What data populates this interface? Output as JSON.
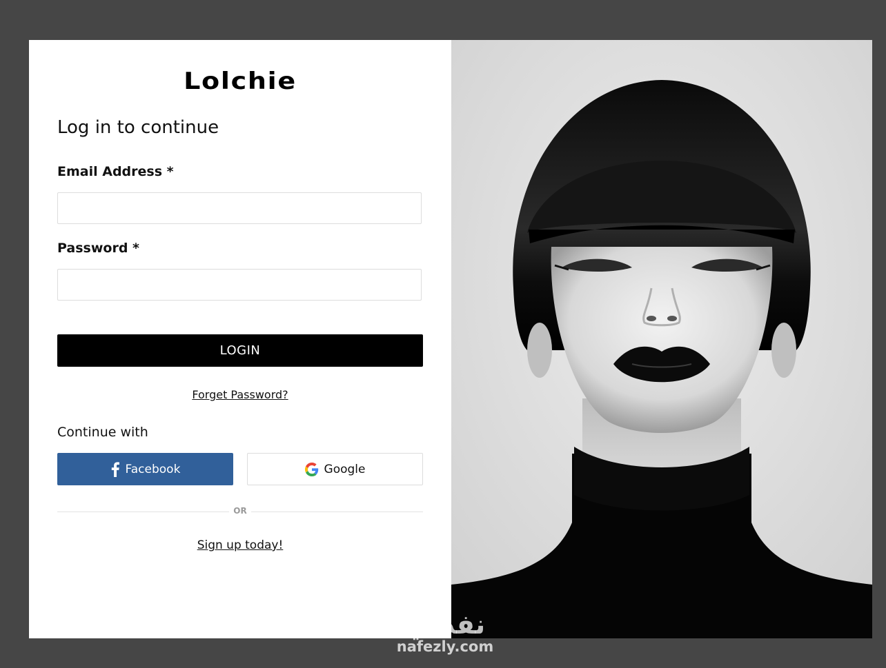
{
  "brand": {
    "logo_text": "Lolchie"
  },
  "form": {
    "heading": "Log in to continue",
    "email_label": "Email Address *",
    "email_value": "",
    "password_label": "Password *",
    "password_value": "",
    "login_label": "LOGIN",
    "forget_label": "Forget Password?"
  },
  "social": {
    "continue_label": "Continue with",
    "facebook_label": "Facebook",
    "google_label": "Google",
    "facebook_icon": "facebook-icon",
    "google_icon": "google-icon",
    "facebook_color": "#31609a"
  },
  "divider": {
    "or_label": "OR"
  },
  "signup": {
    "label": "Sign up today!"
  },
  "hero": {
    "description": "black and white portrait"
  },
  "watermark": {
    "arabic": "نفذلي",
    "latin": "nafezly.com"
  },
  "colors": {
    "backdrop": "#464646",
    "button_primary": "#000000",
    "facebook": "#31609a"
  }
}
